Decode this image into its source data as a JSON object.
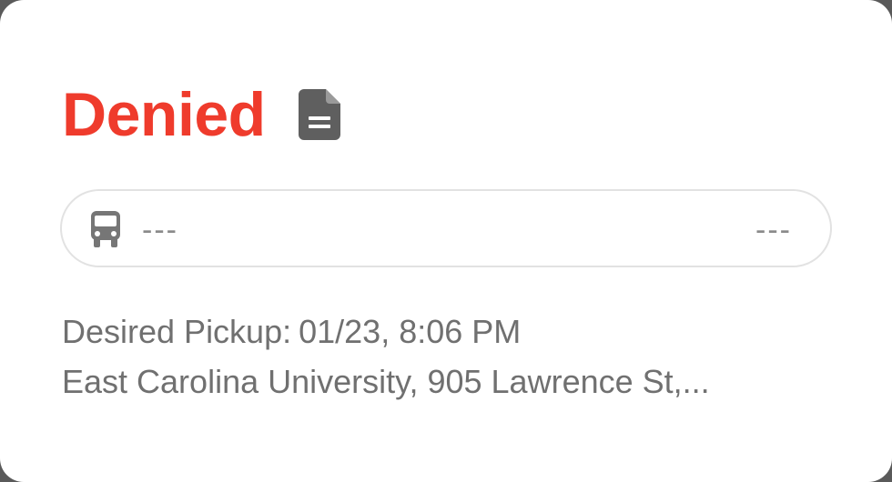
{
  "status": {
    "label": "Denied",
    "color": "#ef3b2c",
    "icon": "document-icon"
  },
  "route": {
    "icon": "bus-icon",
    "from": "---",
    "to": "---"
  },
  "pickup": {
    "label": "Desired Pickup:",
    "value": "01/23, 8:06 PM"
  },
  "address": "East Carolina University, 905 Lawrence St,..."
}
